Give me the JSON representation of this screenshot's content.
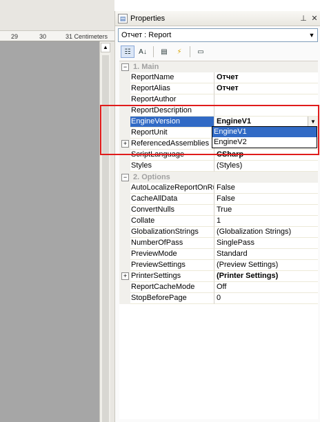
{
  "ruler": {
    "ticks": [
      "29",
      "30",
      "31 Centimeters"
    ]
  },
  "panel": {
    "title": "Properties",
    "pin_icon": "pin-icon",
    "close_icon": "close-icon",
    "object_selector": "Отчет : Report"
  },
  "toolbar": {
    "buttons": [
      "categorized-icon",
      "alphabetical-icon",
      "properties-icon",
      "events-icon",
      "property-pages-icon"
    ]
  },
  "grid": {
    "categories": [
      {
        "label": "1. Main",
        "rows": [
          {
            "name": "ReportName",
            "value": "Отчет",
            "bold": true
          },
          {
            "name": "ReportAlias",
            "value": "Отчет",
            "bold": true
          },
          {
            "name": "ReportAuthor",
            "value": ""
          },
          {
            "name": "ReportDescription",
            "value": ""
          },
          {
            "name": "EngineVersion",
            "value": "EngineV1",
            "selected": true
          },
          {
            "name": "ReportUnit",
            "value": ""
          },
          {
            "name": "ReferencedAssemblies",
            "value": "",
            "expandable": true
          },
          {
            "name": "ScriptLanguage",
            "value": "CSharp",
            "bold": true
          },
          {
            "name": "Styles",
            "value": "(Styles)"
          }
        ]
      },
      {
        "label": "2. Options",
        "rows": [
          {
            "name": "AutoLocalizeReportOnRu",
            "value": "False"
          },
          {
            "name": "CacheAllData",
            "value": "False"
          },
          {
            "name": "ConvertNulls",
            "value": "True"
          },
          {
            "name": "Collate",
            "value": "1"
          },
          {
            "name": "GlobalizationStrings",
            "value": "(Globalization Strings)"
          },
          {
            "name": "NumberOfPass",
            "value": "SinglePass"
          },
          {
            "name": "PreviewMode",
            "value": "Standard"
          },
          {
            "name": "PreviewSettings",
            "value": "(Preview Settings)"
          },
          {
            "name": "PrinterSettings",
            "value": "(Printer Settings)",
            "bold": true,
            "expandable": true
          },
          {
            "name": "ReportCacheMode",
            "value": "Off"
          },
          {
            "name": "StopBeforePage",
            "value": "0"
          }
        ]
      }
    ]
  },
  "dropdown": {
    "options": [
      "EngineV1",
      "EngineV2"
    ],
    "highlighted": 0
  },
  "colors": {
    "selection": "#316ac5",
    "highlight_frame": "#e01b1b",
    "designer_page": "#a6a6a6"
  }
}
